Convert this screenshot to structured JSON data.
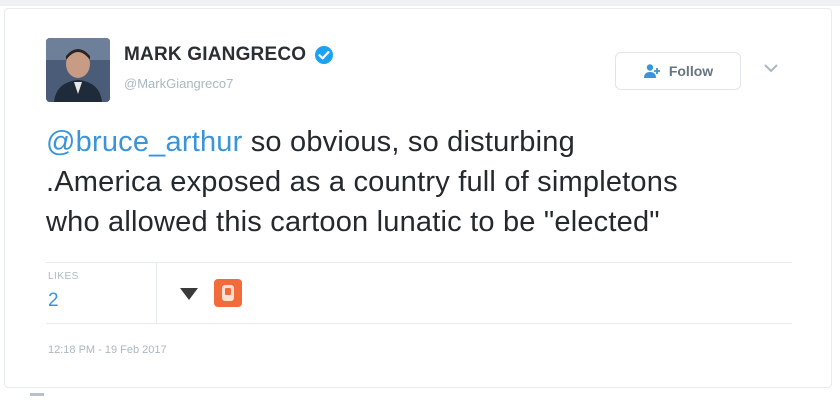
{
  "tweet": {
    "author_name": "MARK GIANGRECO",
    "author_handle": "@MarkGiangreco7",
    "mention": "@bruce_arthur",
    "text_line1": " so obvious, so disturbing",
    "text_line2": ".America exposed as a country full of simpletons",
    "text_line3": "who allowed  this cartoon lunatic  to be \"elected\"",
    "likes_label": "LIKES",
    "likes_count": "2",
    "timestamp": "12:18 PM - 19 Feb 2017"
  },
  "follow_button": {
    "label": "Follow",
    "icon": "add-user-icon"
  },
  "icons": {
    "verified": "verified-badge-icon",
    "more": "chevron-down-icon",
    "reactors": [
      "downvote-icon",
      "user-avatar-icon"
    ]
  },
  "colors": {
    "mention": "#3b94d9",
    "verified": "#1da1f2",
    "reactor_orange": "#f26b3a"
  }
}
